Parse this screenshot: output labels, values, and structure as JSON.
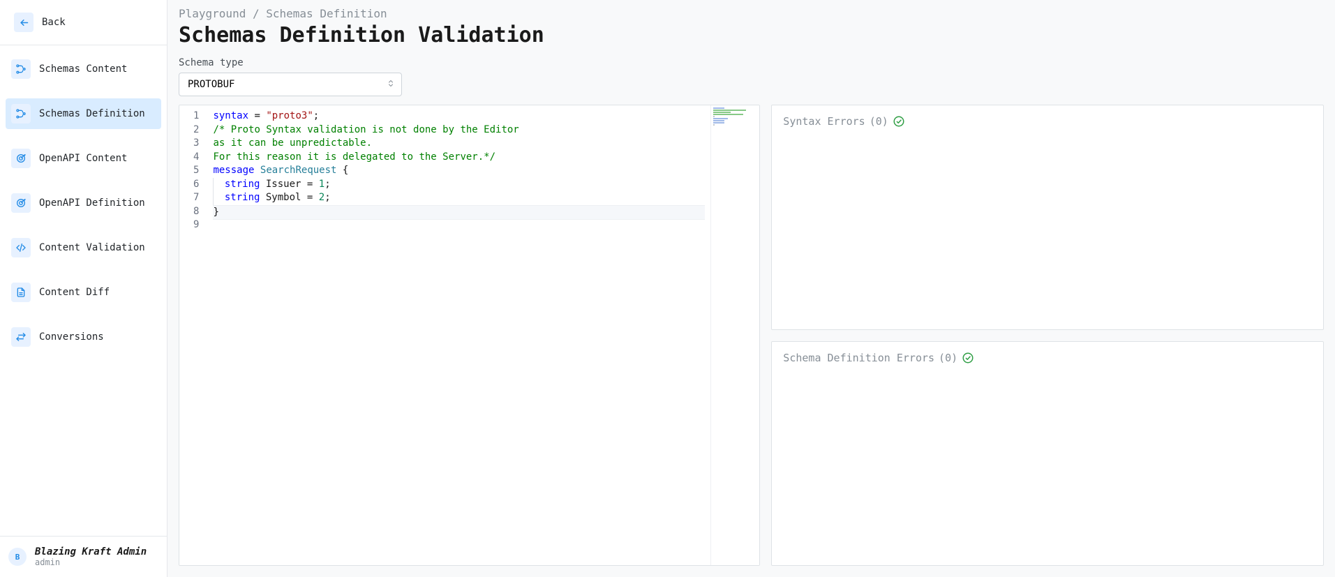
{
  "sidebar": {
    "back_label": "Back",
    "items": [
      {
        "label": "Schemas Content",
        "icon": "tree-icon"
      },
      {
        "label": "Schemas Definition",
        "icon": "tree-icon"
      },
      {
        "label": "OpenAPI Content",
        "icon": "target-icon"
      },
      {
        "label": "OpenAPI Definition",
        "icon": "target-icon"
      },
      {
        "label": "Content Validation",
        "icon": "code-icon"
      },
      {
        "label": "Content Diff",
        "icon": "file-icon"
      },
      {
        "label": "Conversions",
        "icon": "swap-icon"
      }
    ],
    "active_index": 1
  },
  "footer": {
    "avatar_initial": "B",
    "name": "Blazing Kraft Admin",
    "role": "admin"
  },
  "breadcrumb": {
    "root": "Playground",
    "sep": "/",
    "leaf": "Schemas Definition"
  },
  "page_title": "Schemas Definition Validation",
  "schema_type": {
    "label": "Schema type",
    "value": "PROTOBUF"
  },
  "editor": {
    "line_numbers": [
      "1",
      "2",
      "3",
      "4",
      "5",
      "6",
      "7",
      "8",
      "9"
    ],
    "lines": [
      {
        "tokens": [
          {
            "t": "syntax",
            "c": "kw"
          },
          {
            "t": " = ",
            "c": ""
          },
          {
            "t": "\"proto3\"",
            "c": "str"
          },
          {
            "t": ";",
            "c": ""
          }
        ]
      },
      {
        "tokens": [
          {
            "t": "/* Proto Syntax validation is not done by the Editor",
            "c": "com"
          }
        ]
      },
      {
        "tokens": [
          {
            "t": "as it can be unpredictable.",
            "c": "com"
          }
        ]
      },
      {
        "tokens": [
          {
            "t": "For this reason it is delegated to the Server.*/",
            "c": "com"
          }
        ]
      },
      {
        "tokens": [
          {
            "t": "",
            "c": ""
          }
        ]
      },
      {
        "tokens": [
          {
            "t": "message",
            "c": "kw"
          },
          {
            "t": " ",
            "c": ""
          },
          {
            "t": "SearchRequest",
            "c": "type"
          },
          {
            "t": " ",
            "c": ""
          },
          {
            "t": "{",
            "c": "brace"
          }
        ]
      },
      {
        "indent": 1,
        "tokens": [
          {
            "t": "string",
            "c": "kw"
          },
          {
            "t": " Issuer = ",
            "c": ""
          },
          {
            "t": "1",
            "c": "num"
          },
          {
            "t": ";",
            "c": ""
          }
        ]
      },
      {
        "indent": 1,
        "tokens": [
          {
            "t": "string",
            "c": "kw"
          },
          {
            "t": " Symbol = ",
            "c": ""
          },
          {
            "t": "2",
            "c": "num"
          },
          {
            "t": ";",
            "c": ""
          }
        ]
      },
      {
        "cursor": true,
        "tokens": [
          {
            "t": "}",
            "c": "brace"
          }
        ]
      }
    ]
  },
  "panels": {
    "syntax_errors": {
      "label": "Syntax Errors",
      "count": 0
    },
    "schema_errors": {
      "label": "Schema Definition Errors",
      "count": 0
    }
  }
}
